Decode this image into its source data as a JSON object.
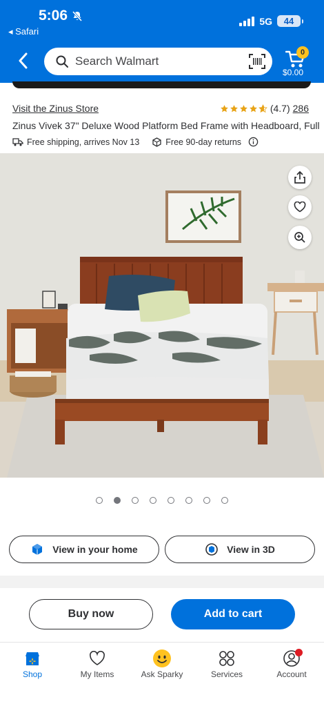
{
  "status_bar": {
    "time": "5:06",
    "back_app": "Safari",
    "network": "5G",
    "battery": "44"
  },
  "header": {
    "search_placeholder": "Search Walmart",
    "cart_count": "0",
    "cart_total": "$0.00"
  },
  "product": {
    "store_link": "Visit the Zinus Store",
    "rating": "(4.7)",
    "rating_value": 4.7,
    "review_count": "286",
    "title": "Zinus Vivek 37\" Deluxe Wood Platform Bed Frame with Headboard, Full",
    "shipping": "Free shipping, arrives Nov 13",
    "returns": "Free 90-day returns"
  },
  "gallery": {
    "total_images": 8,
    "active_index": 1
  },
  "actions": {
    "view_home": "View in your home",
    "view_3d": "View in 3D",
    "buy_now": "Buy now",
    "add_to_cart": "Add to cart"
  },
  "nav": {
    "items": [
      {
        "label": "Shop",
        "icon": "shop-icon",
        "active": true
      },
      {
        "label": "My Items",
        "icon": "heart-icon"
      },
      {
        "label": "Ask Sparky",
        "icon": "sparky-icon"
      },
      {
        "label": "Services",
        "icon": "services-icon"
      },
      {
        "label": "Account",
        "icon": "account-icon"
      }
    ]
  },
  "colors": {
    "brand_blue": "#0071dc",
    "spark_yellow": "#ffc220",
    "notification_red": "#de1c24"
  }
}
